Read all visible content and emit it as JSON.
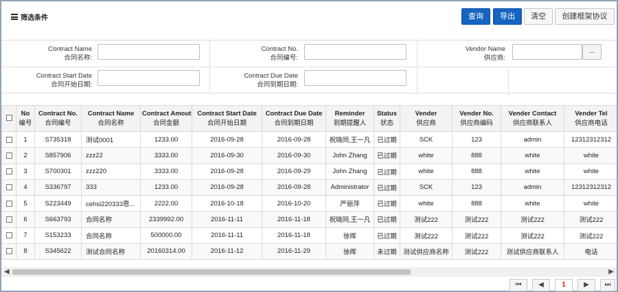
{
  "header": {
    "title": "筛选条件",
    "buttons": {
      "query": "查询",
      "export": "导出",
      "clear": "清空",
      "create": "创建框架协议"
    }
  },
  "filters": {
    "contract_name": {
      "label_en": "Contract Name",
      "label_cn": "合同名称:",
      "value": ""
    },
    "contract_no": {
      "label_en": "Contract No.",
      "label_cn": "合同编号:",
      "value": ""
    },
    "vendor_name": {
      "label_en": "Vendor Name",
      "label_cn": "供应商:",
      "value": "",
      "button": "..."
    },
    "start_date": {
      "label_en": "Contract Start Date",
      "label_cn": "合同开始日期:",
      "value": ""
    },
    "due_date": {
      "label_en": "Contract Due Date",
      "label_cn": "合同到期日期:",
      "value": ""
    }
  },
  "table": {
    "columns": [
      {
        "en": "No",
        "cn": "编号"
      },
      {
        "en": "Contract No.",
        "cn": "合同编号"
      },
      {
        "en": "Contract Name",
        "cn": "合同名称"
      },
      {
        "en": "Contract Amout",
        "cn": "合同金额"
      },
      {
        "en": "Contract Start Date",
        "cn": "合同开始日期"
      },
      {
        "en": "Contract Due Date",
        "cn": "合同到期日期"
      },
      {
        "en": "Reminder",
        "cn": "到期提醒人"
      },
      {
        "en": "Status",
        "cn": "状态"
      },
      {
        "en": "Vender",
        "cn": "供应商"
      },
      {
        "en": "Vender No.",
        "cn": "供应商编码"
      },
      {
        "en": "Vender Contact",
        "cn": "供应商联系人"
      },
      {
        "en": "Vender Tel",
        "cn": "供应商电话"
      }
    ],
    "rows": [
      [
        "1",
        "S735318",
        "测试0001",
        "1233.00",
        "2016-09-28",
        "2016-09-28",
        "祝晓同,王一凡",
        "已过期",
        "SCK",
        "123",
        "admin",
        "12312312312"
      ],
      [
        "2",
        "S857906",
        "zzz22",
        "3333.00",
        "2016-09-30",
        "2016-09-30",
        "John Zhang",
        "已过期",
        "white",
        "888",
        "white",
        "white"
      ],
      [
        "3",
        "S700301",
        "zzz220",
        "3333.00",
        "2016-09-28",
        "2016-09-29",
        "John Zhang",
        "已过期",
        "white",
        "888",
        "white",
        "white"
      ],
      [
        "4",
        "S336797",
        "333",
        "1233.00",
        "2016-09-28",
        "2016-09-28",
        "Administrator",
        "已过期",
        "SCK",
        "123",
        "admin",
        "12312312312"
      ],
      [
        "5",
        "S223449",
        "cehsi220333恩...",
        "2222.00",
        "2016-10-18",
        "2016-10-20",
        "严丽萍",
        "已过期",
        "white",
        "888",
        "white",
        "white"
      ],
      [
        "6",
        "S663793",
        "合同名称",
        "2339992.00",
        "2016-11-11",
        "2016-11-18",
        "祝晓同,王一凡",
        "已过期",
        "测试222",
        "测试222",
        "测试222",
        "测试222"
      ],
      [
        "7",
        "S153233",
        "合同名称",
        "500000.00",
        "2016-11-11",
        "2016-11-18",
        "徐晖",
        "已过期",
        "测试222",
        "测试222",
        "测试222",
        "测试222"
      ],
      [
        "8",
        "S345622",
        "测试合同名称",
        "20160314.00",
        "2016-11-12",
        "2016-11-29",
        "徐晖",
        "未过期",
        "测试供应商名称",
        "测试222",
        "测试供应商联系人",
        "电话"
      ]
    ]
  },
  "pager": {
    "first": "⏮",
    "prev": "◀",
    "current": "1",
    "next": "▶",
    "last": "⏭"
  },
  "scroll": {
    "left": "◀",
    "right": "▶"
  }
}
